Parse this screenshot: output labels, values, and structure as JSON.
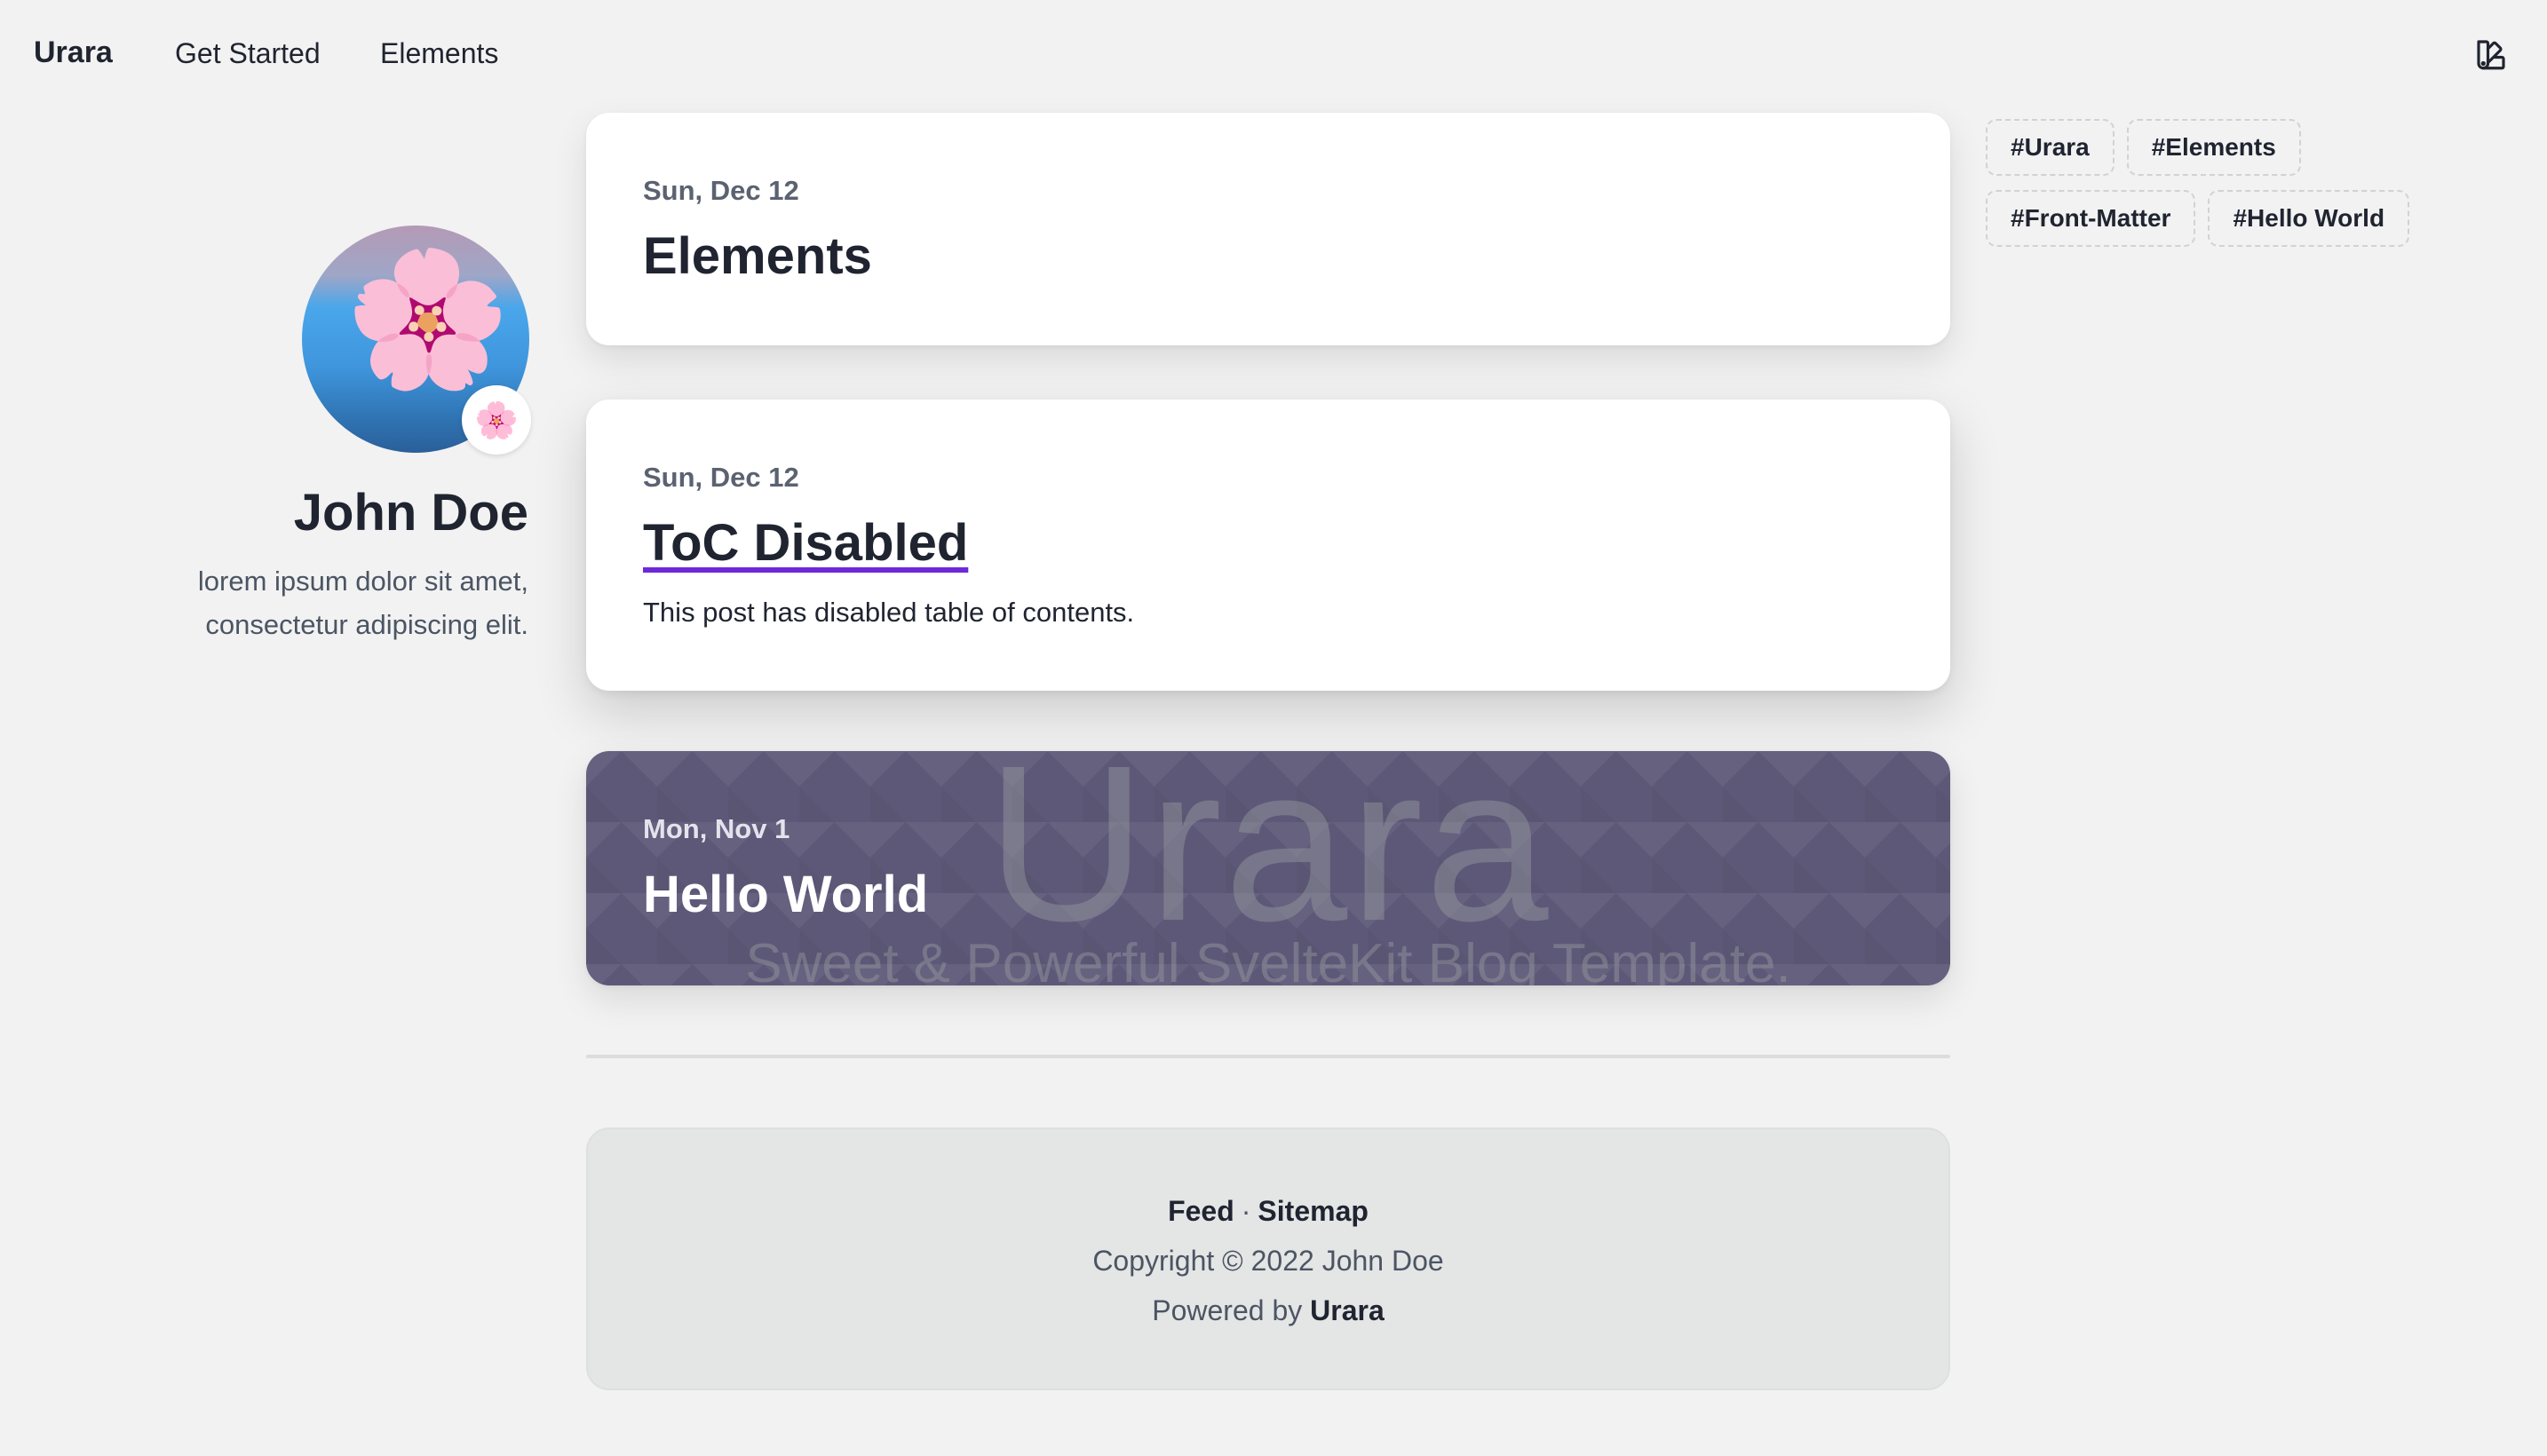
{
  "header": {
    "brand": "Urara",
    "nav": [
      {
        "label": "Get Started"
      },
      {
        "label": "Elements"
      }
    ],
    "theme_icon": "theme-swatch-icon"
  },
  "profile": {
    "name": "John Doe",
    "bio": "lorem ipsum dolor sit amet, consectetur adipiscing elit.",
    "badge_emoji": "🌸",
    "avatar_emoji": "🌸"
  },
  "posts": [
    {
      "date": "Sun, Dec 12",
      "title": "Elements"
    },
    {
      "date": "Sun, Dec 12",
      "title": "ToC Disabled",
      "summary": "This post has disabled table of contents."
    },
    {
      "date": "Mon, Nov 1",
      "title": "Hello World",
      "cover_title": "Urara",
      "cover_subtitle": "Sweet & Powerful SvelteKit Blog Template."
    }
  ],
  "tags": [
    "#Urara",
    "#Elements",
    "#Front-Matter",
    "#Hello World"
  ],
  "footer": {
    "feed": "Feed",
    "sep": "·",
    "sitemap": "Sitemap",
    "copyright": "Copyright © 2022 John Doe",
    "powered_prefix": "Powered by",
    "powered_link": "Urara"
  },
  "colors": {
    "background": "#f2f2f2",
    "accent_underline": "#6d28d9",
    "cover_bg": "#5e5878"
  }
}
